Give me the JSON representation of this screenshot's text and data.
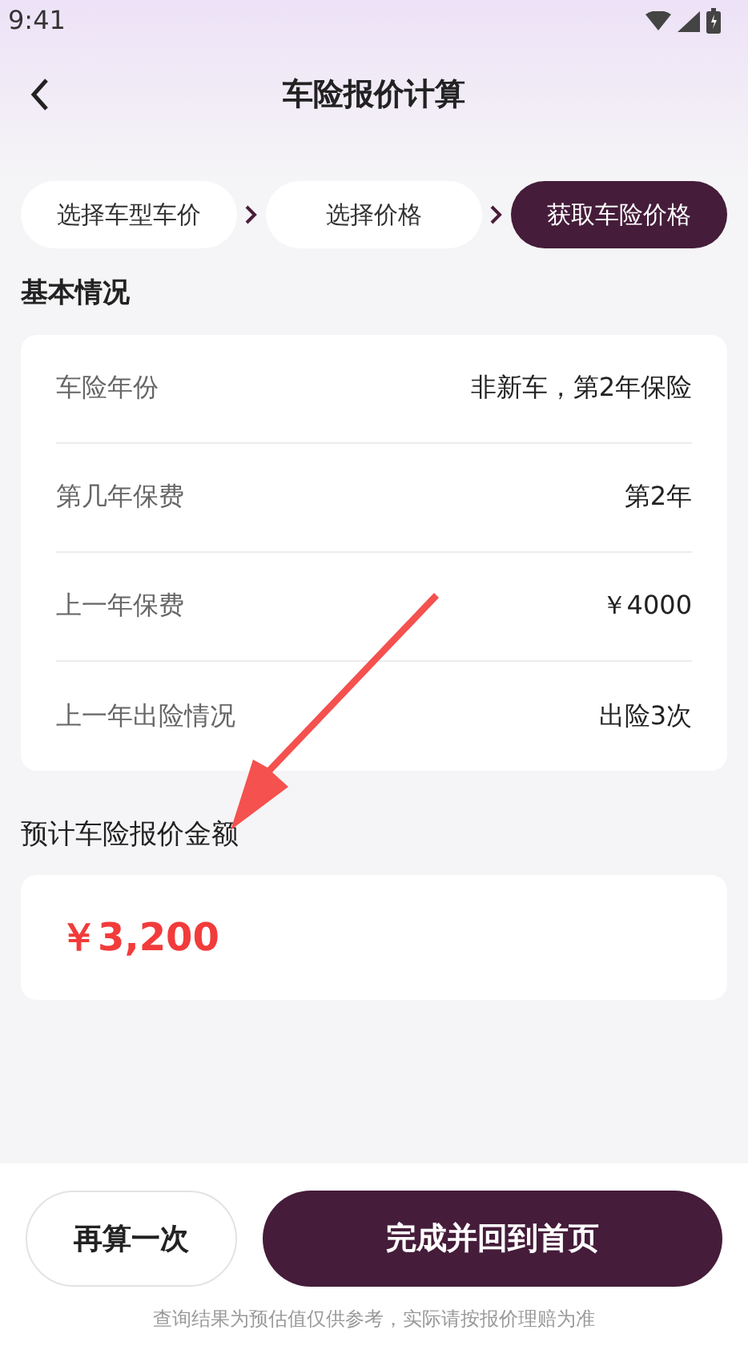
{
  "status_bar": {
    "time": "9:41"
  },
  "header": {
    "title": "车险报价计算"
  },
  "steps": [
    {
      "label": "选择车型车价",
      "selected": false
    },
    {
      "label": "选择价格",
      "selected": false
    },
    {
      "label": "获取车险价格",
      "selected": true
    }
  ],
  "basic_info": {
    "title": "基本情况",
    "rows": [
      {
        "label": "车险年份",
        "value": "非新车，第2年保险"
      },
      {
        "label": "第几年保费",
        "value": "第2年"
      },
      {
        "label": "上一年保费",
        "value": "￥4000"
      },
      {
        "label": "上一年出险情况",
        "value": "出险3次"
      }
    ]
  },
  "estimate": {
    "title": "预计车险报价金额",
    "amount": "￥3,200"
  },
  "buttons": [
    {
      "label": "再算一次",
      "kind": "secondary"
    },
    {
      "label": "完成并回到首页",
      "kind": "primary"
    }
  ],
  "disclaimer": "查询结果为预估值仅供参考，实际请按报价理赔为准"
}
